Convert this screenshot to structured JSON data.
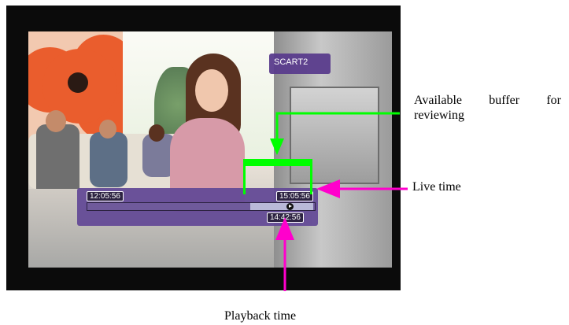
{
  "tv_screen": {
    "source_label": "SCART2",
    "osd": {
      "start_time": "12:05:56",
      "live_time": "15:05:56",
      "playback_time": "14:42:56",
      "progress_fraction": 0.82
    }
  },
  "annotations": {
    "buffer_label_line1": [
      "Available",
      "buffer",
      "for"
    ],
    "buffer_label_line2": "reviewing",
    "live_label": "Live time",
    "playback_label": "Playback time",
    "colors": {
      "buffer_bracket": "#00ff00",
      "arrow": "#ff00cc"
    }
  }
}
